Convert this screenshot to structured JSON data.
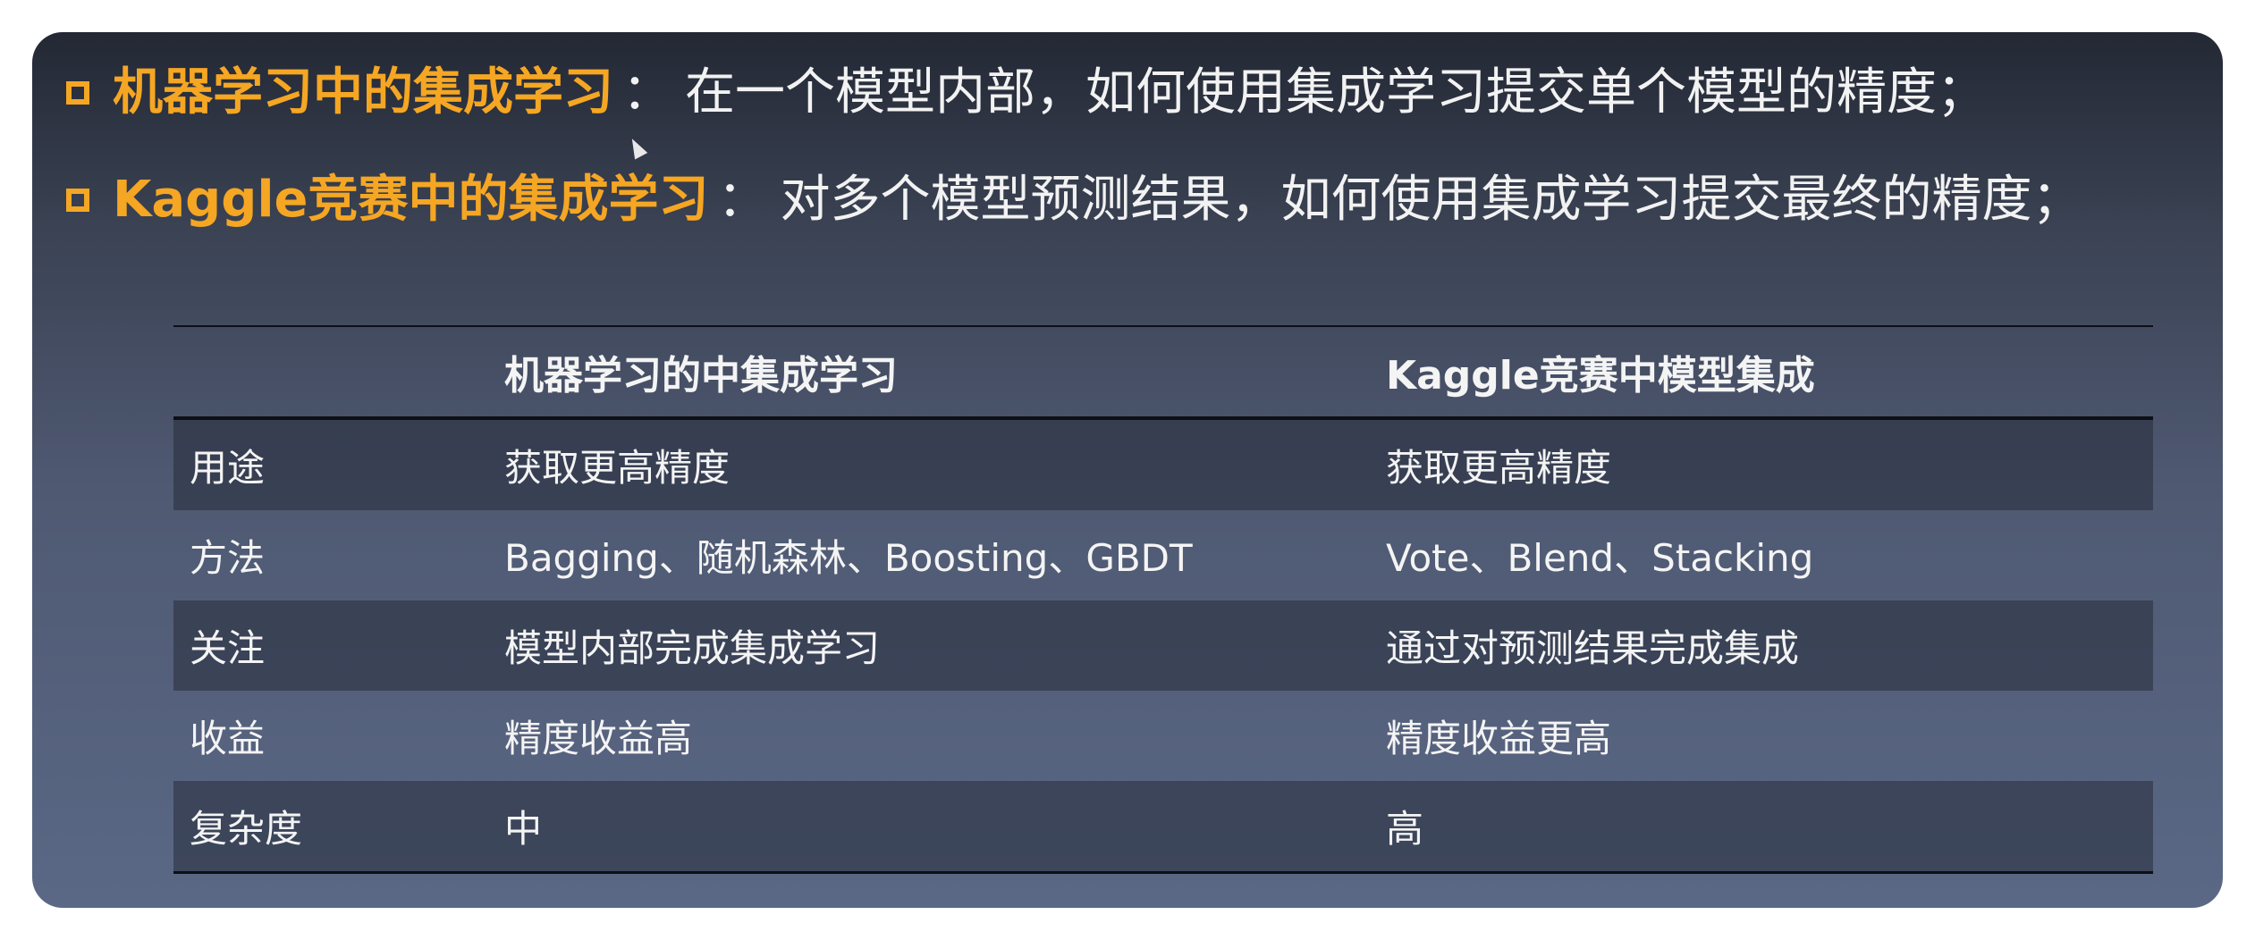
{
  "bullets": [
    {
      "highlight": "机器学习中的集成学习",
      "separator": "：",
      "description": "在一个模型内部，如何使用集成学习提交单个模型的精度；"
    },
    {
      "highlight": "Kaggle竞赛中的集成学习",
      "separator": "：",
      "description": "对多个模型预测结果，如何使用集成学习提交最终的精度；"
    }
  ],
  "table": {
    "headers": [
      "",
      "机器学习的中集成学习",
      "Kaggle竞赛中模型集成"
    ],
    "rows": [
      [
        "用途",
        "获取更高精度",
        "获取更高精度"
      ],
      [
        "方法",
        "Bagging、随机森林、Boosting、GBDT",
        "Vote、Blend、Stacking"
      ],
      [
        "关注",
        "模型内部完成集成学习",
        "通过对预测结果完成集成"
      ],
      [
        "收益",
        "精度收益高",
        "精度收益更高"
      ],
      [
        "复杂度",
        "中",
        "高"
      ]
    ]
  },
  "colors": {
    "accent": "#f5a623",
    "text": "#f2f2f2",
    "background_top": "#232834",
    "background_bottom": "#5a6886"
  }
}
